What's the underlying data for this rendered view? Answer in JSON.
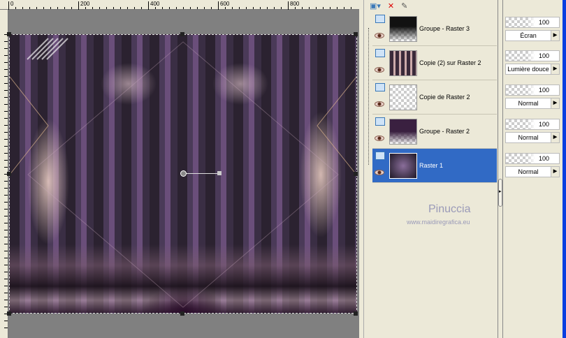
{
  "ruler": {
    "labels": [
      "0",
      "200",
      "400",
      "600",
      "800"
    ]
  },
  "toolbar": {
    "new_layer": "new-layer",
    "delete": "delete-layer",
    "edit": "edit"
  },
  "layers": [
    {
      "name": "Groupe - Raster 3",
      "opacity": "100",
      "blend": "Écran",
      "selected": false
    },
    {
      "name": "Copie (2) sur Raster 2",
      "opacity": "100",
      "blend": "Lumière douce",
      "selected": false
    },
    {
      "name": "Copie de Raster 2",
      "opacity": "100",
      "blend": "Normal",
      "selected": false
    },
    {
      "name": "Groupe - Raster 2",
      "opacity": "100",
      "blend": "Normal",
      "selected": false
    },
    {
      "name": "Raster 1",
      "opacity": "100",
      "blend": "Normal",
      "selected": true
    }
  ],
  "watermark": {
    "name": "Pinuccia",
    "url": "www.maidiregrafica.eu"
  },
  "colors": {
    "selection": "#316ac5",
    "panel": "#ece9d8",
    "canvas_bg": "#808080"
  }
}
